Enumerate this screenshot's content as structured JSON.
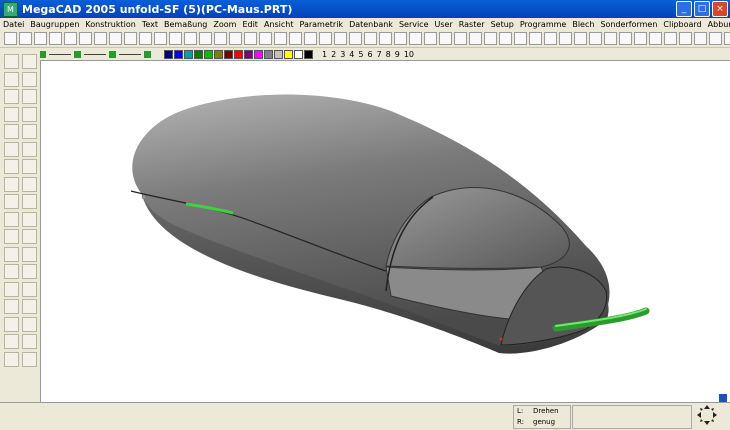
{
  "window": {
    "title": "MegaCAD 2005 unfold-SF (5)(PC-Maus.PRT)",
    "controls": {
      "minimize": "_",
      "maximize": "□",
      "close": "×"
    }
  },
  "menu": [
    "Datei",
    "Baugruppen",
    "Konstruktion",
    "Text",
    "Bemaßung",
    "Zoom",
    "Edit",
    "Ansicht",
    "Parametrik",
    "Datenbank",
    "Service",
    "User",
    "Raster",
    "Setup",
    "Programme",
    "Blech",
    "Sonderformen",
    "Clipboard",
    "Abbund",
    "?"
  ],
  "toolbar2": {
    "numbers": [
      "1",
      "2",
      "3",
      "4",
      "5",
      "6",
      "7",
      "8",
      "9",
      "10"
    ],
    "palette": [
      "#000080",
      "#0000ff",
      "#00a0a0",
      "#008000",
      "#00c000",
      "#808000",
      "#800000",
      "#ff0000",
      "#800080",
      "#ff00ff",
      "#808080",
      "#c0c0c0",
      "#ffff00",
      "#ffffff",
      "#000000"
    ]
  },
  "status": {
    "L_key": "L:",
    "L_value": "Drehen",
    "R_key": "R:",
    "R_value": "genug"
  },
  "model": {
    "name": "PC-Maus"
  },
  "colors": {
    "titlebar": "#0a5fd8",
    "canvas": "#ffffff",
    "cable": "#3fd13f",
    "body": "#6b6b6b"
  }
}
